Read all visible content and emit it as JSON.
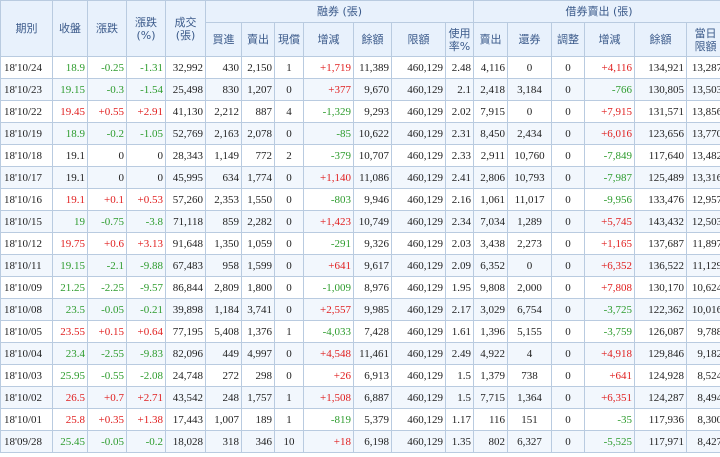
{
  "headers": {
    "date": "期別",
    "close": "收盤",
    "change": "漲跌",
    "change_pct": "漲跌\n(%)",
    "volume": "成交\n(張)",
    "margin_group": "融券 (張)",
    "borrow_group": "借券賣出 (張)",
    "m_buy": "買進",
    "m_sell": "賣出",
    "m_repay": "現償",
    "m_change": "增減",
    "m_balance": "餘額",
    "m_limit": "限額",
    "m_usage": "使用\n率%",
    "b_sell": "賣出",
    "b_return": "還券",
    "b_adjust": "調整",
    "b_change": "增減",
    "b_balance": "餘額",
    "b_today_limit": "當日\n限額"
  },
  "colors": {
    "up": "#e02020",
    "down": "#2e9c2e",
    "header_bg": "#e8f1fc",
    "header_text": "#3b5a8a",
    "border": "#b9cbe0"
  },
  "rows": [
    {
      "date": "18'10/24",
      "close": "18.9",
      "close_dir": "down",
      "change": "-0.25",
      "change_pct": "-1.31",
      "volume": "32,992",
      "m_buy": "430",
      "m_sell": "2,150",
      "m_repay": "1",
      "m_change": "+1,719",
      "m_balance": "11,389",
      "m_limit": "460,129",
      "m_usage": "2.48",
      "b_sell": "4,116",
      "b_return": "0",
      "b_adjust": "0",
      "b_change": "+4,116",
      "b_balance": "134,921",
      "b_today_limit": "13,287"
    },
    {
      "date": "18'10/23",
      "close": "19.15",
      "close_dir": "down",
      "change": "-0.3",
      "change_pct": "-1.54",
      "volume": "25,498",
      "m_buy": "830",
      "m_sell": "1,207",
      "m_repay": "0",
      "m_change": "+377",
      "m_balance": "9,670",
      "m_limit": "460,129",
      "m_usage": "2.1",
      "b_sell": "2,418",
      "b_return": "3,184",
      "b_adjust": "0",
      "b_change": "-766",
      "b_balance": "130,805",
      "b_today_limit": "13,503"
    },
    {
      "date": "18'10/22",
      "close": "19.45",
      "close_dir": "up",
      "change": "+0.55",
      "change_pct": "+2.91",
      "volume": "41,130",
      "m_buy": "2,212",
      "m_sell": "887",
      "m_repay": "4",
      "m_change": "-1,329",
      "m_balance": "9,293",
      "m_limit": "460,129",
      "m_usage": "2.02",
      "b_sell": "7,915",
      "b_return": "0",
      "b_adjust": "0",
      "b_change": "+7,915",
      "b_balance": "131,571",
      "b_today_limit": "13,856"
    },
    {
      "date": "18'10/19",
      "close": "18.9",
      "close_dir": "down",
      "change": "-0.2",
      "change_pct": "-1.05",
      "volume": "52,769",
      "m_buy": "2,163",
      "m_sell": "2,078",
      "m_repay": "0",
      "m_change": "-85",
      "m_balance": "10,622",
      "m_limit": "460,129",
      "m_usage": "2.31",
      "b_sell": "8,450",
      "b_return": "2,434",
      "b_adjust": "0",
      "b_change": "+6,016",
      "b_balance": "123,656",
      "b_today_limit": "13,770"
    },
    {
      "date": "18'10/18",
      "close": "19.1",
      "close_dir": "flat",
      "change": "0",
      "change_pct": "0",
      "volume": "28,343",
      "m_buy": "1,149",
      "m_sell": "772",
      "m_repay": "2",
      "m_change": "-379",
      "m_balance": "10,707",
      "m_limit": "460,129",
      "m_usage": "2.33",
      "b_sell": "2,911",
      "b_return": "10,760",
      "b_adjust": "0",
      "b_change": "-7,849",
      "b_balance": "117,640",
      "b_today_limit": "13,482"
    },
    {
      "date": "18'10/17",
      "close": "19.1",
      "close_dir": "flat",
      "change": "0",
      "change_pct": "0",
      "volume": "45,995",
      "m_buy": "634",
      "m_sell": "1,774",
      "m_repay": "0",
      "m_change": "+1,140",
      "m_balance": "11,086",
      "m_limit": "460,129",
      "m_usage": "2.41",
      "b_sell": "2,806",
      "b_return": "10,793",
      "b_adjust": "0",
      "b_change": "-7,987",
      "b_balance": "125,489",
      "b_today_limit": "13,316"
    },
    {
      "date": "18'10/16",
      "close": "19.1",
      "close_dir": "up",
      "change": "+0.1",
      "change_pct": "+0.53",
      "volume": "57,260",
      "m_buy": "2,353",
      "m_sell": "1,550",
      "m_repay": "0",
      "m_change": "-803",
      "m_balance": "9,946",
      "m_limit": "460,129",
      "m_usage": "2.16",
      "b_sell": "1,061",
      "b_return": "11,017",
      "b_adjust": "0",
      "b_change": "-9,956",
      "b_balance": "133,476",
      "b_today_limit": "12,957"
    },
    {
      "date": "18'10/15",
      "close": "19",
      "close_dir": "down",
      "change": "-0.75",
      "change_pct": "-3.8",
      "volume": "71,118",
      "m_buy": "859",
      "m_sell": "2,282",
      "m_repay": "0",
      "m_change": "+1,423",
      "m_balance": "10,749",
      "m_limit": "460,129",
      "m_usage": "2.34",
      "b_sell": "7,034",
      "b_return": "1,289",
      "b_adjust": "0",
      "b_change": "+5,745",
      "b_balance": "143,432",
      "b_today_limit": "12,503"
    },
    {
      "date": "18'10/12",
      "close": "19.75",
      "close_dir": "up",
      "change": "+0.6",
      "change_pct": "+3.13",
      "volume": "91,648",
      "m_buy": "1,350",
      "m_sell": "1,059",
      "m_repay": "0",
      "m_change": "-291",
      "m_balance": "9,326",
      "m_limit": "460,129",
      "m_usage": "2.03",
      "b_sell": "3,438",
      "b_return": "2,273",
      "b_adjust": "0",
      "b_change": "+1,165",
      "b_balance": "137,687",
      "b_today_limit": "11,897"
    },
    {
      "date": "18'10/11",
      "close": "19.15",
      "close_dir": "down",
      "change": "-2.1",
      "change_pct": "-9.88",
      "volume": "67,483",
      "m_buy": "958",
      "m_sell": "1,599",
      "m_repay": "0",
      "m_change": "+641",
      "m_balance": "9,617",
      "m_limit": "460,129",
      "m_usage": "2.09",
      "b_sell": "6,352",
      "b_return": "0",
      "b_adjust": "0",
      "b_change": "+6,352",
      "b_balance": "136,522",
      "b_today_limit": "11,129"
    },
    {
      "date": "18'10/09",
      "close": "21.25",
      "close_dir": "down",
      "change": "-2.25",
      "change_pct": "-9.57",
      "volume": "86,844",
      "m_buy": "2,809",
      "m_sell": "1,800",
      "m_repay": "0",
      "m_change": "-1,009",
      "m_balance": "8,976",
      "m_limit": "460,129",
      "m_usage": "1.95",
      "b_sell": "9,808",
      "b_return": "2,000",
      "b_adjust": "0",
      "b_change": "+7,808",
      "b_balance": "130,170",
      "b_today_limit": "10,624"
    },
    {
      "date": "18'10/08",
      "close": "23.5",
      "close_dir": "down",
      "change": "-0.05",
      "change_pct": "-0.21",
      "volume": "39,898",
      "m_buy": "1,184",
      "m_sell": "3,741",
      "m_repay": "0",
      "m_change": "+2,557",
      "m_balance": "9,985",
      "m_limit": "460,129",
      "m_usage": "2.17",
      "b_sell": "3,029",
      "b_return": "6,754",
      "b_adjust": "0",
      "b_change": "-3,725",
      "b_balance": "122,362",
      "b_today_limit": "10,016"
    },
    {
      "date": "18'10/05",
      "close": "23.55",
      "close_dir": "up",
      "change": "+0.15",
      "change_pct": "+0.64",
      "volume": "77,195",
      "m_buy": "5,408",
      "m_sell": "1,376",
      "m_repay": "1",
      "m_change": "-4,033",
      "m_balance": "7,428",
      "m_limit": "460,129",
      "m_usage": "1.61",
      "b_sell": "1,396",
      "b_return": "5,155",
      "b_adjust": "0",
      "b_change": "-3,759",
      "b_balance": "126,087",
      "b_today_limit": "9,788"
    },
    {
      "date": "18'10/04",
      "close": "23.4",
      "close_dir": "down",
      "change": "-2.55",
      "change_pct": "-9.83",
      "volume": "82,096",
      "m_buy": "449",
      "m_sell": "4,997",
      "m_repay": "0",
      "m_change": "+4,548",
      "m_balance": "11,461",
      "m_limit": "460,129",
      "m_usage": "2.49",
      "b_sell": "4,922",
      "b_return": "4",
      "b_adjust": "0",
      "b_change": "+4,918",
      "b_balance": "129,846",
      "b_today_limit": "9,182"
    },
    {
      "date": "18'10/03",
      "close": "25.95",
      "close_dir": "down",
      "change": "-0.55",
      "change_pct": "-2.08",
      "volume": "24,748",
      "m_buy": "272",
      "m_sell": "298",
      "m_repay": "0",
      "m_change": "+26",
      "m_balance": "6,913",
      "m_limit": "460,129",
      "m_usage": "1.5",
      "b_sell": "1,379",
      "b_return": "738",
      "b_adjust": "0",
      "b_change": "+641",
      "b_balance": "124,928",
      "b_today_limit": "8,524"
    },
    {
      "date": "18'10/02",
      "close": "26.5",
      "close_dir": "up",
      "change": "+0.7",
      "change_pct": "+2.71",
      "volume": "43,542",
      "m_buy": "248",
      "m_sell": "1,757",
      "m_repay": "1",
      "m_change": "+1,508",
      "m_balance": "6,887",
      "m_limit": "460,129",
      "m_usage": "1.5",
      "b_sell": "7,715",
      "b_return": "1,364",
      "b_adjust": "0",
      "b_change": "+6,351",
      "b_balance": "124,287",
      "b_today_limit": "8,494"
    },
    {
      "date": "18'10/01",
      "close": "25.8",
      "close_dir": "up",
      "change": "+0.35",
      "change_pct": "+1.38",
      "volume": "17,443",
      "m_buy": "1,007",
      "m_sell": "189",
      "m_repay": "1",
      "m_change": "-819",
      "m_balance": "5,379",
      "m_limit": "460,129",
      "m_usage": "1.17",
      "b_sell": "116",
      "b_return": "151",
      "b_adjust": "0",
      "b_change": "-35",
      "b_balance": "117,936",
      "b_today_limit": "8,300"
    },
    {
      "date": "18'09/28",
      "close": "25.45",
      "close_dir": "down",
      "change": "-0.05",
      "change_pct": "-0.2",
      "volume": "18,028",
      "m_buy": "318",
      "m_sell": "346",
      "m_repay": "10",
      "m_change": "+18",
      "m_balance": "6,198",
      "m_limit": "460,129",
      "m_usage": "1.35",
      "b_sell": "802",
      "b_return": "6,327",
      "b_adjust": "0",
      "b_change": "-5,525",
      "b_balance": "117,971",
      "b_today_limit": "8,427"
    }
  ]
}
